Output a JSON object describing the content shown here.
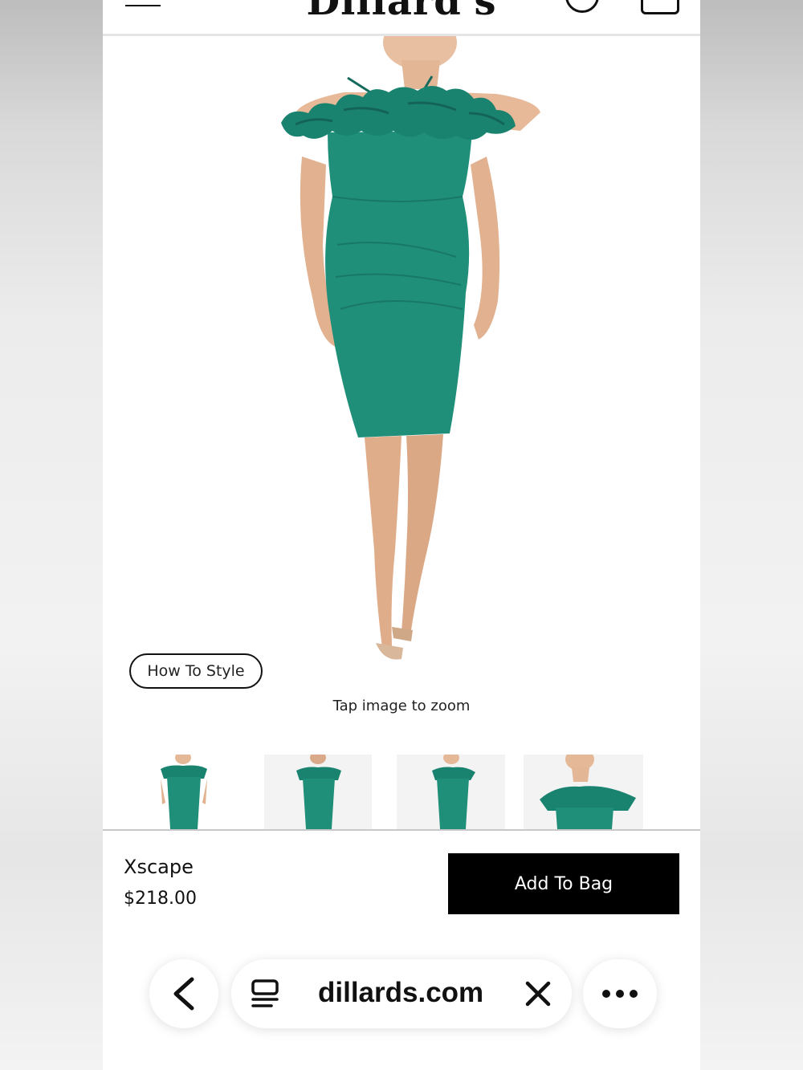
{
  "header": {
    "logo": "Dillard's",
    "menu_icon": "hamburger-menu-icon",
    "search_icon": "search-icon",
    "bag_icon": "shopping-bag-icon"
  },
  "product": {
    "how_to_style": "How To Style",
    "zoom_hint": "Tap image to zoom",
    "brand": "Xscape",
    "price": "$218.00",
    "add_to_bag": "Add To Bag",
    "dress_color": "#1f8f7a",
    "thumbnails": [
      "thumbnail-front",
      "thumbnail-back",
      "thumbnail-side",
      "thumbnail-detail"
    ]
  },
  "browser": {
    "url": "dillards.com",
    "back_icon": "chevron-left-icon",
    "reader_icon": "reader-mode-icon",
    "close_icon": "close-icon",
    "more_icon": "more-dots-icon"
  }
}
